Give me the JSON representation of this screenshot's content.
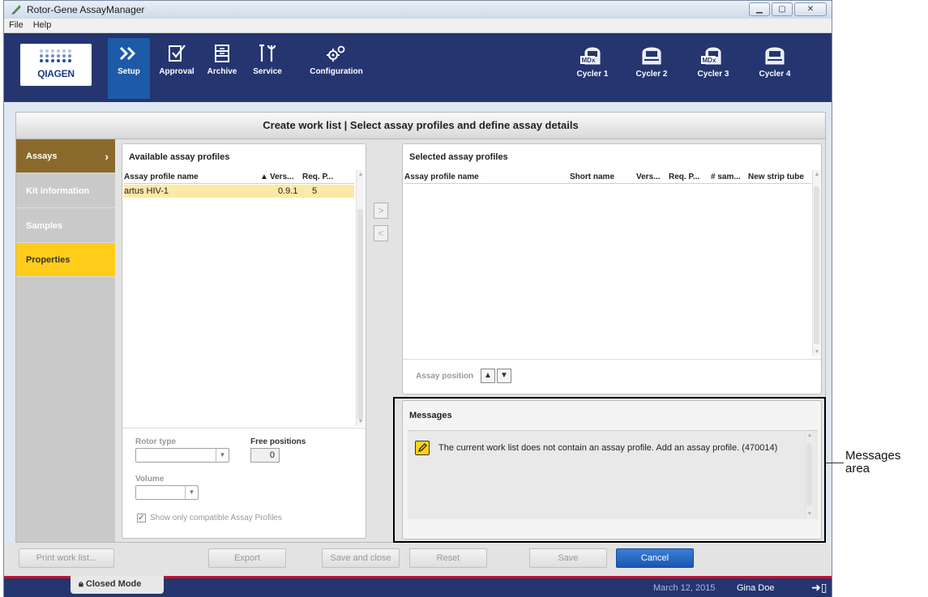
{
  "window": {
    "title": "Rotor-Gene AssayManager",
    "buttons": [
      "minimize",
      "maximize",
      "close"
    ]
  },
  "menu": {
    "items": [
      "File",
      "Help"
    ]
  },
  "toolbar": {
    "logo_text": "QIAGEN",
    "nav": [
      {
        "label": "Setup",
        "icon": "setup-icon",
        "active": true
      },
      {
        "label": "Approval",
        "icon": "approval-icon",
        "active": false
      },
      {
        "label": "Archive",
        "icon": "archive-icon",
        "active": false
      },
      {
        "label": "Service",
        "icon": "service-icon",
        "active": false
      },
      {
        "label": "Configuration",
        "icon": "configuration-icon",
        "active": false
      }
    ],
    "cyclers": [
      {
        "label": "Cycler 1",
        "mdx": true
      },
      {
        "label": "Cycler 2",
        "mdx": false
      },
      {
        "label": "Cycler 3",
        "mdx": true
      },
      {
        "label": "Cycler 4",
        "mdx": false
      }
    ],
    "mdx_badge": "MDx"
  },
  "header": {
    "title": "Create work list | Select assay profiles and define assay details"
  },
  "leftnav": {
    "items": [
      {
        "label": "Assays",
        "state": "active"
      },
      {
        "label": "Kit information",
        "state": "disabled"
      },
      {
        "label": "Samples",
        "state": "disabled"
      },
      {
        "label": "Properties",
        "state": "highlight"
      }
    ]
  },
  "available": {
    "title": "Available assay profiles",
    "columns": [
      "Assay profile name",
      "Vers...",
      "Req. P..."
    ],
    "sort_indicator": "▲",
    "rows": [
      {
        "name": "artus HIV-1",
        "version": "0.9.1",
        "req": "5"
      }
    ],
    "rotor_type_label": "Rotor type",
    "free_positions_label": "Free positions",
    "free_positions_value": "0",
    "volume_label": "Volume",
    "compatible_label": "Show only compatible Assay Profiles"
  },
  "transfer": {
    "add": ">",
    "remove": "<"
  },
  "selected": {
    "title": "Selected assay profiles",
    "columns": [
      "Assay profile name",
      "Short name",
      "Vers...",
      "Req. P...",
      "# sam...",
      "New strip tube"
    ],
    "assay_position_label": "Assay position",
    "up": "▲",
    "down": "▼"
  },
  "messages": {
    "title": "Messages",
    "items": [
      {
        "icon": "pencil-icon",
        "text": "The current work list does not contain an assay profile. Add an assay profile. (470014)"
      }
    ]
  },
  "buttons": {
    "print": "Print work list...",
    "export": "Export",
    "save_close": "Save and close",
    "reset": "Reset",
    "save": "Save",
    "cancel": "Cancel"
  },
  "status": {
    "mode": "Closed Mode",
    "date": "March 12, 2015",
    "user": "Gina Doe"
  },
  "annotation": {
    "label_line1": "Messages",
    "label_line2": "area"
  },
  "colors": {
    "toolbar": "#253570",
    "active_tab": "#1d5aa8",
    "accent_red": "#c8102e",
    "nav_active": "#8a6a2c",
    "nav_highlight": "#ffcc1a",
    "row_selected": "#fde9a6",
    "primary_button": "#1a56b0"
  }
}
